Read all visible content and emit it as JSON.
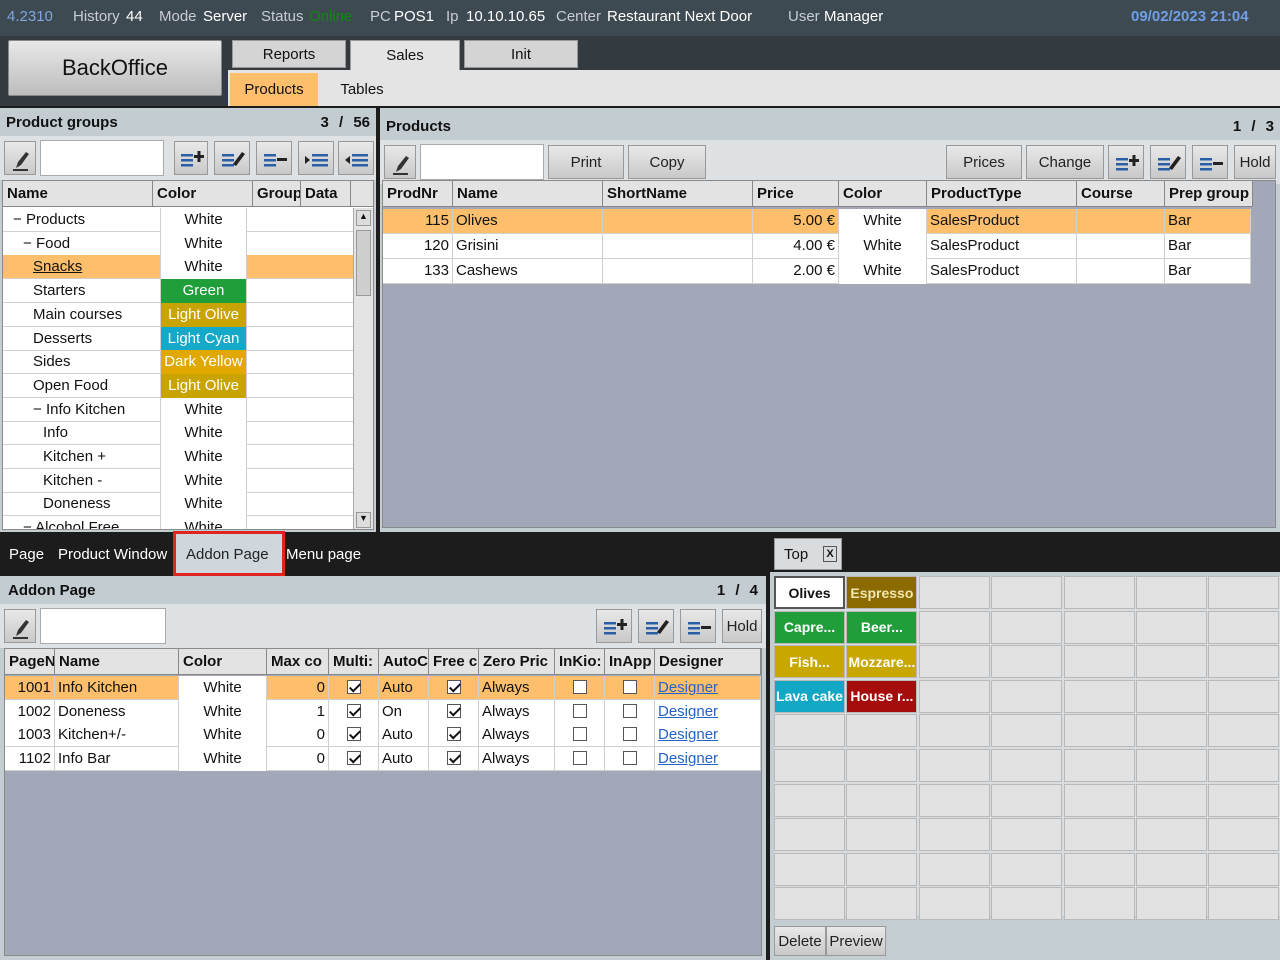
{
  "status": {
    "version": "4.2310",
    "history_label": "History",
    "history_value": "44",
    "mode_label": "Mode",
    "mode_value": "Server",
    "status_label": "Status",
    "status_value": "Online",
    "pc_label": "PC",
    "pc_value": "POS1",
    "ip_label": "Ip",
    "ip_value": "10.10.10.65",
    "center_label": "Center",
    "center_value": "Restaurant Next Door",
    "user_label": "User",
    "user_value": "Manager",
    "datetime": "09/02/2023 21:04"
  },
  "nav": {
    "backoffice": "BackOffice",
    "main_tabs": [
      "Reports",
      "Sales",
      "Init"
    ],
    "sub_tabs": [
      "Products",
      "Tables"
    ]
  },
  "product_groups": {
    "title": "Product groups",
    "counter": "3 / 56",
    "columns": [
      "Name",
      "Color",
      "Group",
      "Data"
    ],
    "rows": [
      {
        "name": "Products",
        "prefix": "−",
        "indent": 0,
        "color": "White"
      },
      {
        "name": "Food",
        "prefix": "−",
        "indent": 1,
        "color": "White"
      },
      {
        "name": "Snacks",
        "prefix": "",
        "indent": 2,
        "color": "White"
      },
      {
        "name": "Starters",
        "prefix": "",
        "indent": 2,
        "color": "Green"
      },
      {
        "name": "Main courses",
        "prefix": "",
        "indent": 2,
        "color": "Light Olive"
      },
      {
        "name": "Desserts",
        "prefix": "",
        "indent": 2,
        "color": "Light Cyan"
      },
      {
        "name": "Sides",
        "prefix": "",
        "indent": 2,
        "color": "Dark Yellow"
      },
      {
        "name": "Open Food",
        "prefix": "",
        "indent": 2,
        "color": "Light Olive"
      },
      {
        "name": "Info Kitchen",
        "prefix": "−",
        "indent": 2,
        "color": "White"
      },
      {
        "name": "Info",
        "prefix": "",
        "indent": 3,
        "color": "White"
      },
      {
        "name": "Kitchen +",
        "prefix": "",
        "indent": 3,
        "color": "White"
      },
      {
        "name": "Kitchen -",
        "prefix": "",
        "indent": 3,
        "color": "White"
      },
      {
        "name": "Doneness",
        "prefix": "",
        "indent": 3,
        "color": "White"
      },
      {
        "name": "Alcohol Free",
        "prefix": "−",
        "indent": 1,
        "color": "White"
      }
    ]
  },
  "products": {
    "title": "Products",
    "counter": "1 / 3",
    "buttons": {
      "print": "Print",
      "copy": "Copy",
      "prices": "Prices",
      "change": "Change",
      "hold": "Hold"
    },
    "columns": [
      "ProdNr",
      "Name",
      "ShortName",
      "Price",
      "Color",
      "ProductType",
      "Course",
      "Prep group"
    ],
    "rows": [
      {
        "nr": "115",
        "name": "Olives",
        "short": "",
        "price": "5.00 €",
        "color": "White",
        "type": "SalesProduct",
        "course": "",
        "prep": "Bar"
      },
      {
        "nr": "120",
        "name": "Grisini",
        "short": "",
        "price": "4.00 €",
        "color": "White",
        "type": "SalesProduct",
        "course": "",
        "prep": "Bar"
      },
      {
        "nr": "133",
        "name": "Cashews",
        "short": "",
        "price": "2.00 €",
        "color": "White",
        "type": "SalesProduct",
        "course": "",
        "prep": "Bar"
      }
    ]
  },
  "bottom_tabs": [
    "Page",
    "Product Window",
    "Addon Page",
    "Menu page"
  ],
  "addon_page": {
    "title": "Addon Page",
    "counter": "1 / 4",
    "hold": "Hold",
    "columns": [
      "PageN",
      "Name",
      "Color",
      "Max co",
      "Multi:",
      "AutoC",
      "Free c",
      "Zero Pric",
      "InKio:",
      "InApp",
      "Designer"
    ],
    "rows": [
      {
        "nr": "1001",
        "name": "Info Kitchen",
        "color": "White",
        "max": "0",
        "multi": true,
        "auto": "Auto",
        "free": true,
        "zero": "Always",
        "kiosk": false,
        "app": false,
        "designer": "Designer"
      },
      {
        "nr": "1002",
        "name": "Doneness",
        "color": "White",
        "max": "1",
        "multi": true,
        "auto": "On",
        "free": true,
        "zero": "Always",
        "kiosk": false,
        "app": false,
        "designer": "Designer"
      },
      {
        "nr": "1003",
        "name": "Kitchen+/-",
        "color": "White",
        "max": "0",
        "multi": true,
        "auto": "Auto",
        "free": true,
        "zero": "Always",
        "kiosk": false,
        "app": false,
        "designer": "Designer"
      },
      {
        "nr": "1102",
        "name": "Info Bar",
        "color": "White",
        "max": "0",
        "multi": true,
        "auto": "Auto",
        "free": true,
        "zero": "Always",
        "kiosk": false,
        "app": false,
        "designer": "Designer"
      }
    ]
  },
  "top_panel": {
    "tab": "Top",
    "close": "X",
    "tiles": [
      {
        "label": "Olives",
        "bg": "#ffffff",
        "fg": "#111111"
      },
      {
        "label": "Espresso",
        "bg": "#8b6a00",
        "fg": "#f0e6b0"
      },
      {
        "label": "Capre...",
        "bg": "#1f9e3a",
        "fg": "#ffffff"
      },
      {
        "label": "Beer...",
        "bg": "#1f9e3a",
        "fg": "#ffffff"
      },
      {
        "label": "Fish...",
        "bg": "#c8a800",
        "fg": "#ffffff"
      },
      {
        "label": "Mozzare...",
        "bg": "#c8a800",
        "fg": "#ffffff"
      },
      {
        "label": "Lava cake",
        "bg": "#12a7c4",
        "fg": "#ffffff"
      },
      {
        "label": "House r...",
        "bg": "#a50d0d",
        "fg": "#ffffff"
      }
    ],
    "delete": "Delete",
    "preview": "Preview"
  },
  "colors": {
    "White": "#ffffff",
    "Green": "#1f9e3a",
    "Light Olive": "#c9a400",
    "Light Cyan": "#14a9c9",
    "Dark Yellow": "#e0a800",
    "selection": "#fdbf6b"
  }
}
